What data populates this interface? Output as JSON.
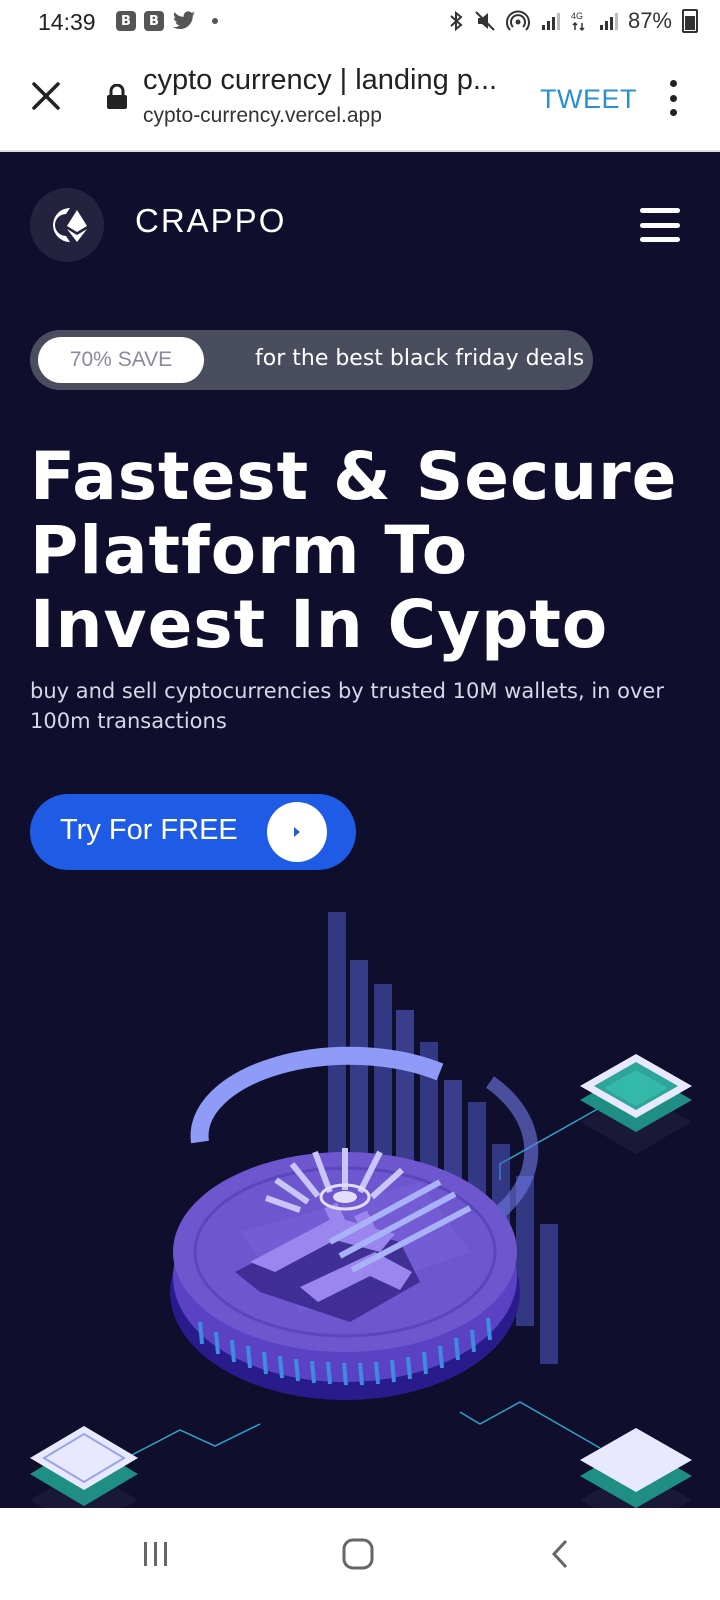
{
  "status_bar": {
    "time": "14:39",
    "left_icons": [
      "B",
      "B"
    ],
    "battery": "87%",
    "icons": [
      "bluetooth-icon",
      "mute-icon",
      "hotspot-icon",
      "signal-icon",
      "4g-icon",
      "signal-icon",
      "battery-icon"
    ]
  },
  "browser": {
    "page_title": "cypto currency | landing p...",
    "url": "cypto-currency.vercel.app",
    "tweet_label": "TWEET"
  },
  "site": {
    "brand": "CRAPPO",
    "promo": {
      "badge": "70% SAVE",
      "text": "for the best black friday deals"
    },
    "hero": {
      "headline": "Fastest & Secure Platform To Invest In Cypto",
      "subtext": "buy and sell cyptocurrencies by trusted 10M wallets, in over 100m transactions",
      "cta_label": "Try For FREE"
    }
  },
  "colors": {
    "page_bg": "#0f0e2d",
    "cta_blue": "#1f5ce6",
    "tweet_blue": "#2b8fd6",
    "coin_purple": "#6e56cf",
    "teal": "#2ea59a"
  }
}
